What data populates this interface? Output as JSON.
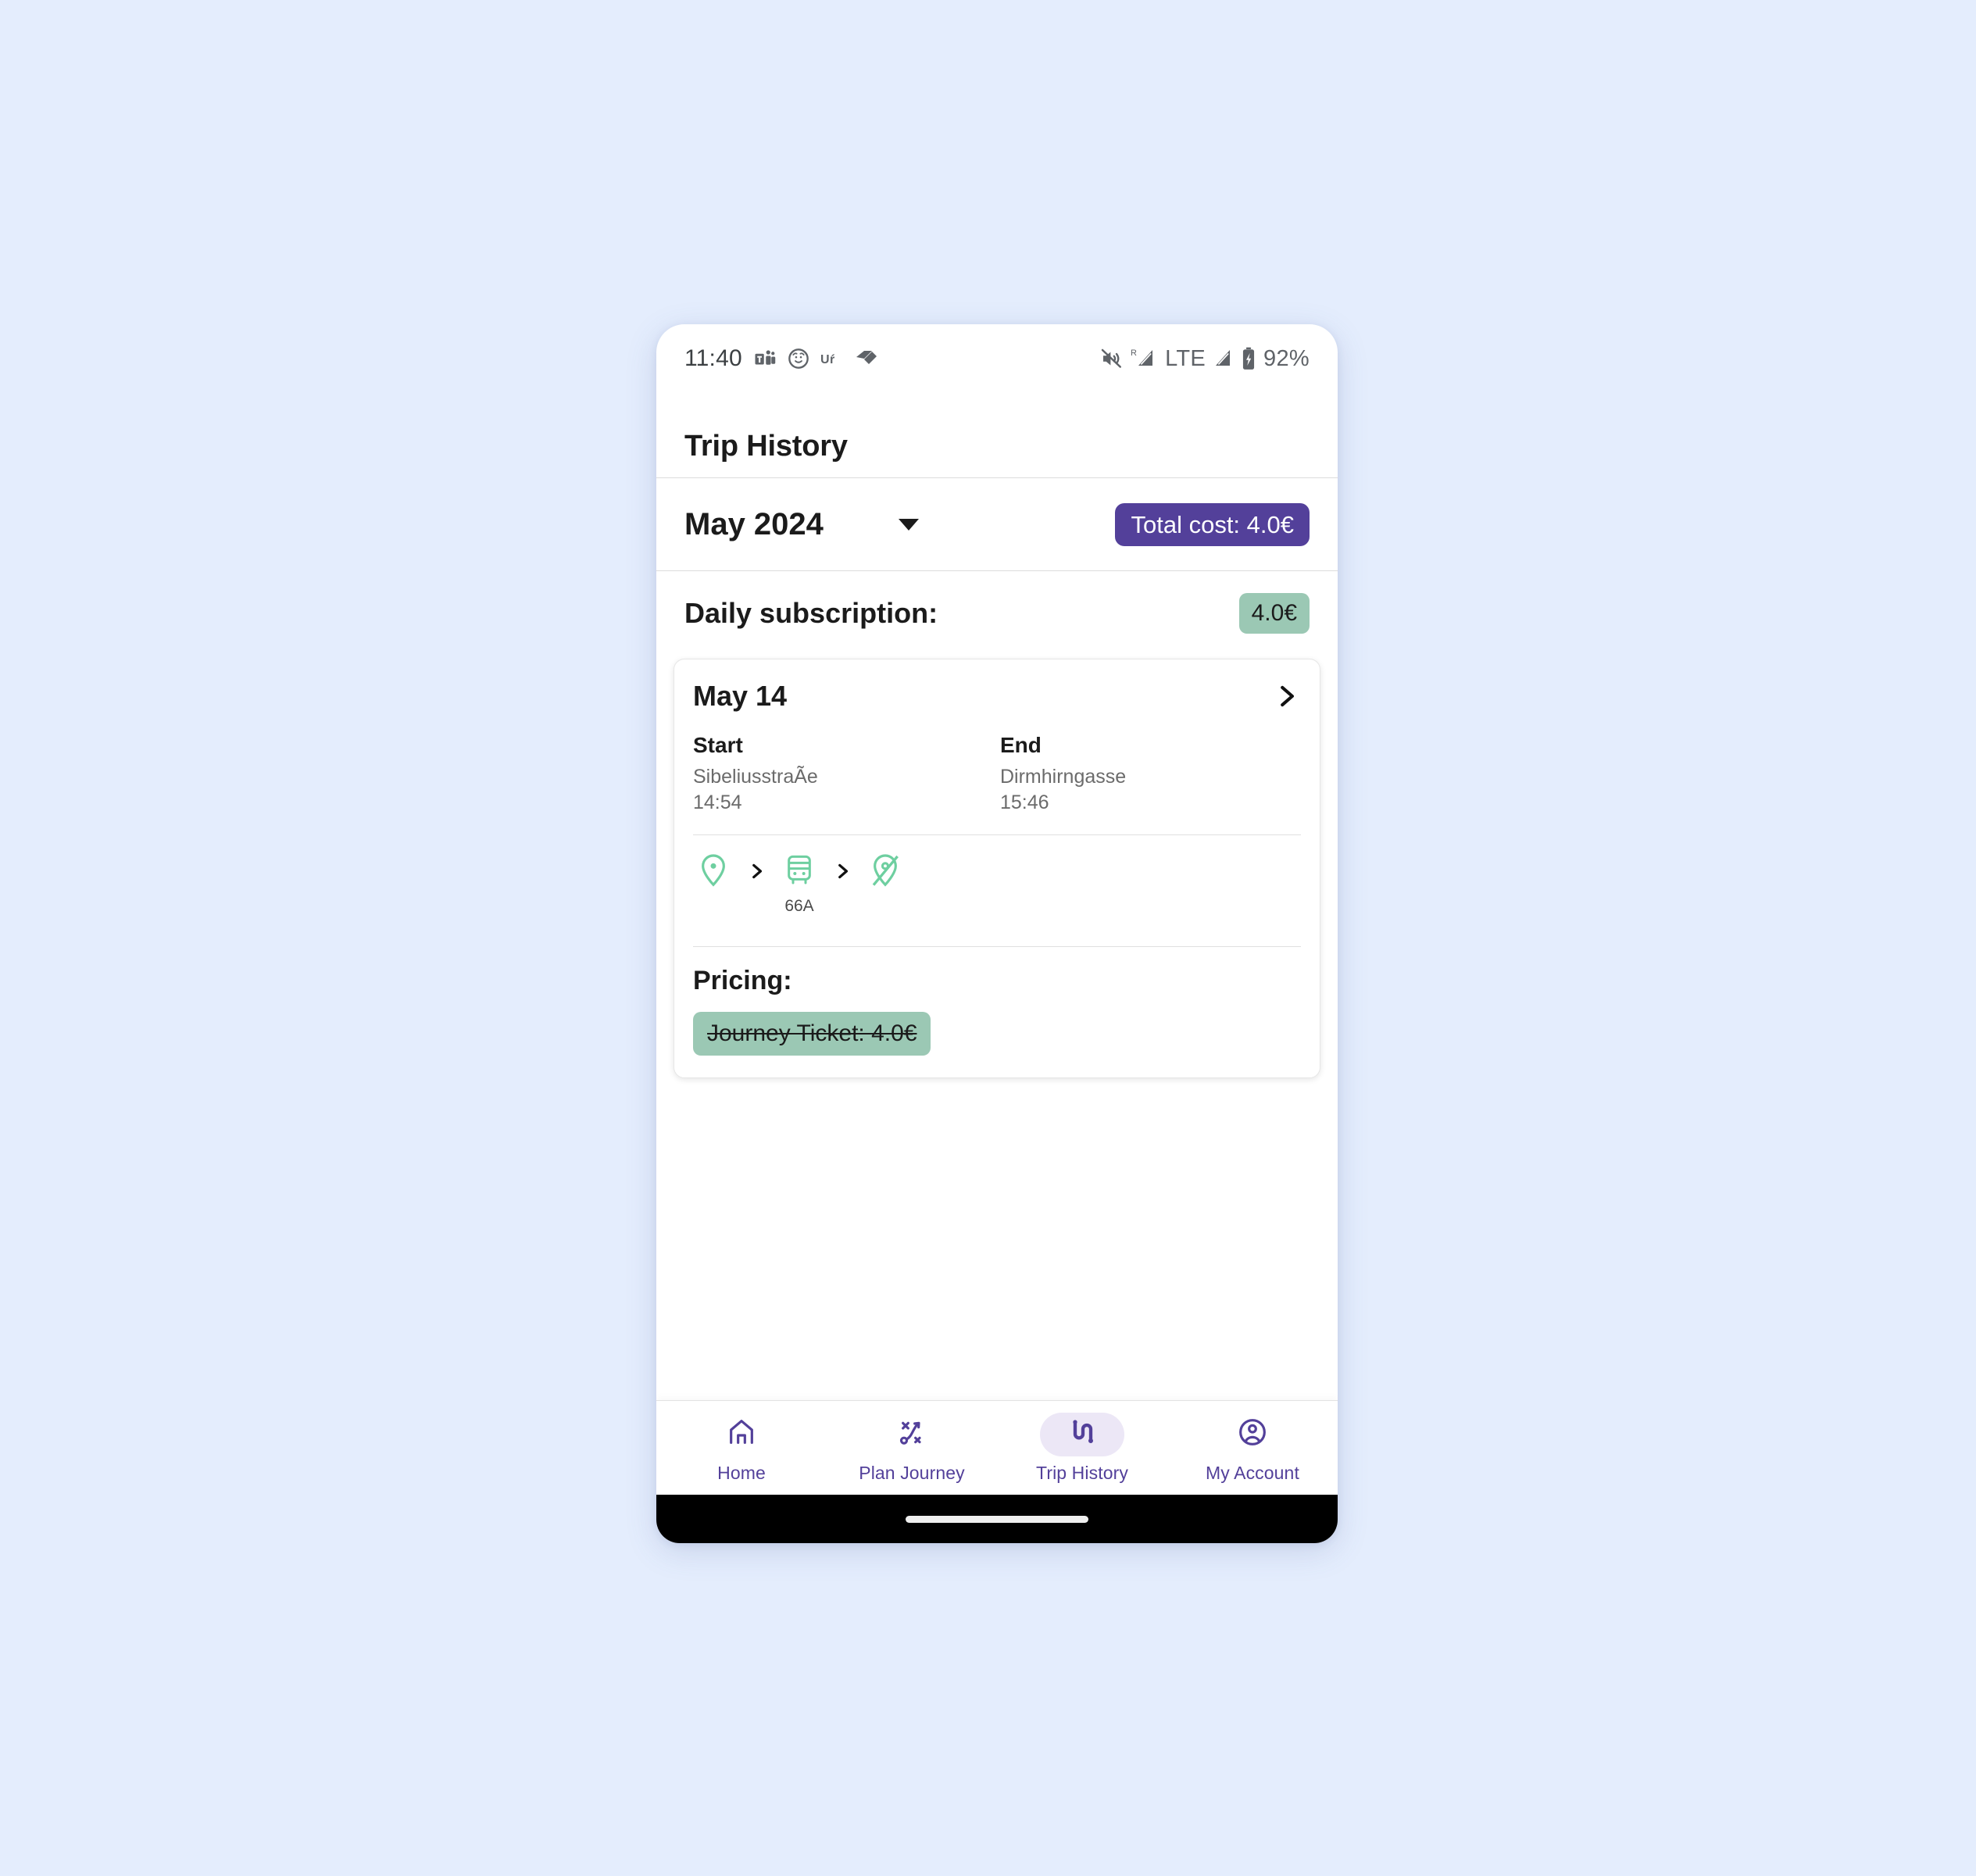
{
  "status_bar": {
    "time": "11:40",
    "notification_icons": [
      "teams-icon",
      "avatar-face-icon",
      "un-app-icon",
      "diamond-tag-icon"
    ],
    "mute_icon": "volume-off-icon",
    "roaming_label": "R",
    "network_type": "LTE",
    "battery_percent": "92%"
  },
  "app_bar": {
    "title": "Trip History"
  },
  "month_selector": {
    "label": "May 2024",
    "dropdown_icon": "chevron-down-icon",
    "total_cost_chip": "Total cost: 4.0€"
  },
  "subscription": {
    "label": "Daily subscription:",
    "amount_chip": "4.0€"
  },
  "trip": {
    "date": "May 14",
    "open_icon": "chevron-right-icon",
    "start": {
      "title": "Start",
      "location": "SibeliusstraÃe",
      "time": "14:54"
    },
    "end": {
      "title": "End",
      "location": "Dirmhirngasse",
      "time": "15:46"
    },
    "legs": [
      {
        "icon": "location-pin-icon",
        "label": ""
      },
      {
        "icon": "chevron-right-icon",
        "label": ""
      },
      {
        "icon": "bus-icon",
        "label": "66A"
      },
      {
        "icon": "chevron-right-icon",
        "label": ""
      },
      {
        "icon": "location-pin-off-icon",
        "label": ""
      }
    ],
    "pricing_title": "Pricing:",
    "pricing_chip": "Journey Ticket: 4.0€"
  },
  "bottom_nav": {
    "items": [
      {
        "label": "Home",
        "icon": "home-icon",
        "active": false
      },
      {
        "label": "Plan Journey",
        "icon": "route-plan-icon",
        "active": false
      },
      {
        "label": "Trip History",
        "icon": "trip-history-icon",
        "active": true
      },
      {
        "label": "My Account",
        "icon": "account-circle-icon",
        "active": false
      }
    ]
  },
  "colors": {
    "page_background": "#e4edfd",
    "primary_purple": "#53409a",
    "accent_green": "#9bc8b4",
    "journey_icon_green": "#6ecfa0",
    "active_pill": "#ece7f6"
  }
}
